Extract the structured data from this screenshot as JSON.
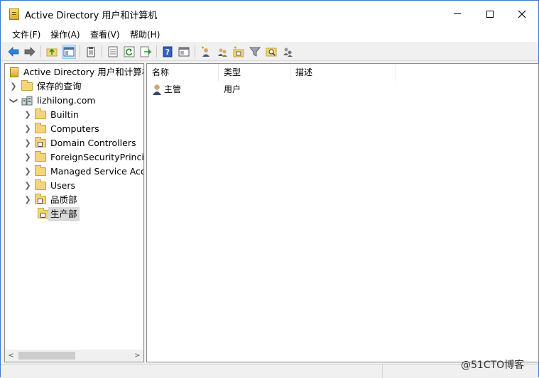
{
  "window": {
    "title": "Active Directory 用户和计算机",
    "controls": {
      "minimize": "—",
      "maximize": "☐",
      "close": "✕"
    }
  },
  "menu": [
    {
      "label": "文件(F)"
    },
    {
      "label": "操作(A)"
    },
    {
      "label": "查看(V)"
    },
    {
      "label": "帮助(H)"
    }
  ],
  "toolbar": {
    "icons": [
      "back-arrow-icon",
      "forward-arrow-icon",
      "up-folder-icon",
      "show-hide-tree-icon",
      "clipboard-icon",
      "properties-icon",
      "refresh-icon",
      "export-list-icon",
      "help-icon",
      "view-icon",
      "new-user-icon",
      "new-group-icon",
      "new-ou-icon",
      "filter-icon",
      "find-icon",
      "add-to-group-icon"
    ]
  },
  "tree": {
    "root": {
      "label": "Active Directory 用户和计算机"
    },
    "saved_queries": {
      "label": "保存的查询"
    },
    "domain": {
      "label": "lizhilong.com"
    },
    "children": [
      {
        "label": "Builtin",
        "type": "folder",
        "selected": false
      },
      {
        "label": "Computers",
        "type": "folder",
        "selected": false
      },
      {
        "label": "Domain Controllers",
        "type": "ou",
        "selected": false
      },
      {
        "label": "ForeignSecurityPrincipals",
        "type": "folder",
        "selected": false
      },
      {
        "label": "Managed Service Accounts",
        "type": "folder",
        "selected": false
      },
      {
        "label": "Users",
        "type": "folder",
        "selected": false
      },
      {
        "label": "品质部",
        "type": "ou",
        "selected": false
      },
      {
        "label": "生产部",
        "type": "ou",
        "selected": true
      }
    ]
  },
  "list": {
    "columns": [
      {
        "label": "名称"
      },
      {
        "label": "类型"
      },
      {
        "label": "描述"
      }
    ],
    "rows": [
      {
        "name": "主管",
        "type": "用户",
        "description": ""
      }
    ]
  },
  "scrollbar": {
    "left_arrow": "<",
    "right_arrow": ">"
  },
  "watermark": "@51CTO博客"
}
